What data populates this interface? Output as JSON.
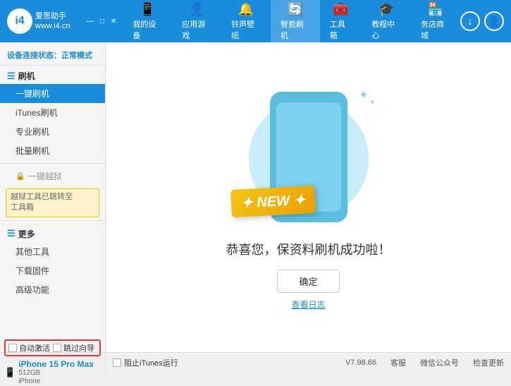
{
  "header": {
    "logo_name": "爱思助手",
    "logo_sub": "www.i4.cn",
    "logo_char": "i4",
    "nav_items": [
      {
        "id": "my-device",
        "icon": "📱",
        "label": "我的设备"
      },
      {
        "id": "apps-games",
        "icon": "👤",
        "label": "应用游戏"
      },
      {
        "id": "ringtone",
        "icon": "🔔",
        "label": "铃声壁纸"
      },
      {
        "id": "smart-flash",
        "icon": "🔄",
        "label": "智能刷机",
        "active": true
      },
      {
        "id": "toolbox",
        "icon": "🧰",
        "label": "工具箱"
      },
      {
        "id": "tutorial",
        "icon": "🎓",
        "label": "教程中心"
      },
      {
        "id": "service",
        "icon": "🏪",
        "label": "务店商域"
      }
    ]
  },
  "sidebar": {
    "status_label": "设备连接状态：",
    "status_value": "正常模式",
    "section_flash": "刷机",
    "items": [
      {
        "id": "one-click",
        "label": "一键刷机",
        "active": true
      },
      {
        "id": "itunes",
        "label": "iTunes刷机"
      },
      {
        "id": "pro-flash",
        "label": "专业刷机"
      },
      {
        "id": "batch-flash",
        "label": "批量刷机"
      }
    ],
    "section_disabled": "一键越狱",
    "notice": "越狱工具已跳转至\n工具箱",
    "section_more": "更多",
    "more_items": [
      {
        "id": "other-tools",
        "label": "其他工具"
      },
      {
        "id": "download-fw",
        "label": "下载固件"
      },
      {
        "id": "advanced",
        "label": "高级功能"
      }
    ]
  },
  "content": {
    "success_text": "恭喜您，保资料刷机成功啦！",
    "confirm_label": "确定",
    "log_label": "查看日志"
  },
  "bottom": {
    "no_itunes_label": "阻止iTunes运行",
    "auto_activate_label": "自动激活",
    "guide_activate_label": "跳过向导",
    "device_name": "iPhone 15 Pro Max",
    "device_storage": "512GB",
    "device_type": "iPhone",
    "version": "V7.98.66",
    "status_items": [
      "客服",
      "微信公众号",
      "检查更新"
    ]
  }
}
